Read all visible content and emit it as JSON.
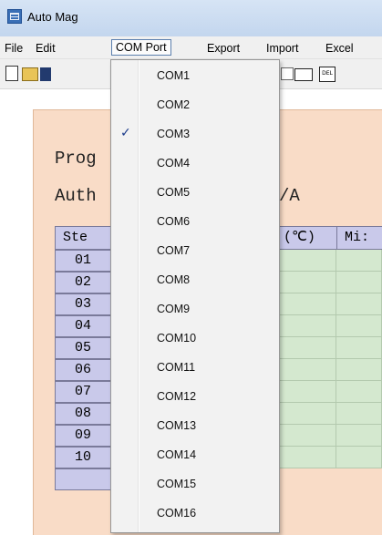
{
  "window": {
    "title": "Auto Mag",
    "app_icon": "app-icon"
  },
  "menubar": {
    "items": [
      {
        "label": "File"
      },
      {
        "label": "Edit"
      },
      {
        "label": "COM Port"
      },
      {
        "label": "Export"
      },
      {
        "label": "Import"
      },
      {
        "label": "Excel"
      }
    ],
    "active_item": "COM Port"
  },
  "toolbar": {
    "icons": [
      "new-document-icon",
      "open-folder-icon",
      "save-disk-icon",
      "image-icon",
      "rectangle-icon",
      "delete-icon"
    ],
    "delete_label": "DEL"
  },
  "content": {
    "program_label": "Prog",
    "author_label": "Auth",
    "author_value_fragment": "/A",
    "table": {
      "header_step": "Ste",
      "header_temp": "(℃)",
      "header_mix": "Mi:",
      "steps": [
        "01",
        "02",
        "03",
        "04",
        "05",
        "06",
        "07",
        "08",
        "09",
        "10"
      ]
    }
  },
  "com_port_menu": {
    "items": [
      "COM1",
      "COM2",
      "COM3",
      "COM4",
      "COM5",
      "COM6",
      "COM7",
      "COM8",
      "COM9",
      "COM10",
      "COM11",
      "COM12",
      "COM13",
      "COM14",
      "COM15",
      "COM16"
    ],
    "checked": "COM3",
    "check_glyph": "✓"
  },
  "colors": {
    "step_cell": "#c9c9ea",
    "data_cell": "#d4e8cf",
    "panel_background": "#f9dcc7",
    "menu_background": "#f2f2f2"
  }
}
